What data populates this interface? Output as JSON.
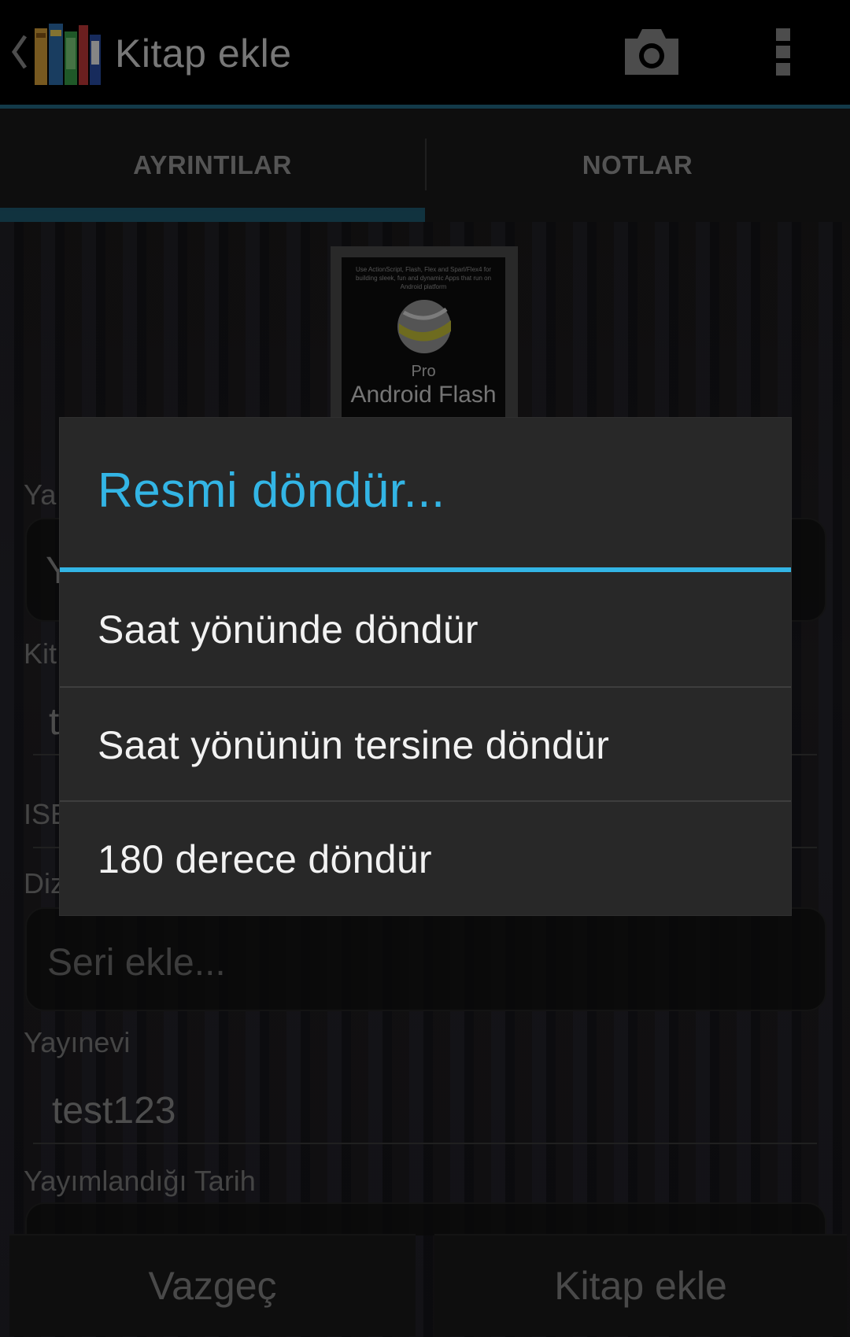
{
  "actionbar": {
    "title": "Kitap ekle",
    "icons": [
      "up-caret-icon",
      "app-logo-icon",
      "camera-icon",
      "overflow-menu-icon"
    ]
  },
  "tabs": [
    {
      "label": "AYRINTILAR",
      "selected": true
    },
    {
      "label": "NOTLAR",
      "selected": false
    }
  ],
  "cover": {
    "pro": "Pro",
    "title": "Android Flash",
    "tagline": "Use ActionScript, Flash, Flex and Sparl/Flex4 for building sleek, fun and dynamic Apps that run on Android platform"
  },
  "form": {
    "author_label_partial": "Ya",
    "author_value_partial": "Y",
    "title_label_partial": "Kit",
    "title_value_partial": "t",
    "isbn_label_partial": "ISE",
    "series_label_partial": "Diz",
    "series_placeholder": "Seri ekle...",
    "publisher_label": "Yayınevi",
    "publisher_value": "test123",
    "pubdate_label": "Yayımlandığı Tarih"
  },
  "buttons": {
    "cancel": "Vazgeç",
    "add": "Kitap ekle"
  },
  "dialog": {
    "title": "Resmi döndür...",
    "items": [
      "Saat yönünde döndür",
      "Saat yönünün tersine döndür",
      "180 derece döndür"
    ]
  },
  "colors": {
    "accent": "#33b5e5",
    "tab_indicator": "#1f5d74",
    "dialog_bg": "#282828"
  }
}
